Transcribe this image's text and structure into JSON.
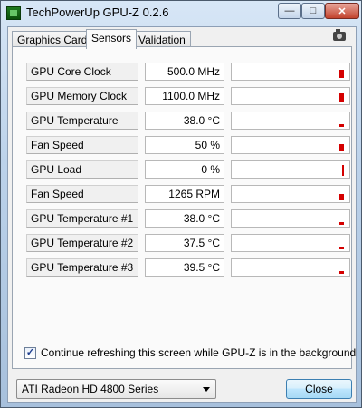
{
  "window": {
    "title": "TechPowerUp GPU-Z 0.2.6"
  },
  "tabs": [
    {
      "label": "Graphics Card",
      "active": false
    },
    {
      "label": "Sensors",
      "active": true
    },
    {
      "label": "Validation",
      "active": false
    }
  ],
  "icons": {
    "app": "gpuz-app-icon",
    "camera": "camera-icon",
    "minimize": "minimize-icon",
    "maximize": "maximize-icon",
    "close": "close-icon",
    "dropdown": "chevron-down-icon"
  },
  "colors": {
    "graph_bar": "#d40000",
    "close_button_border": "#3c7fb1"
  },
  "sensors": [
    {
      "label": "GPU Core Clock",
      "value": "500.0 MHz"
    },
    {
      "label": "GPU Memory Clock",
      "value": "1100.0 MHz"
    },
    {
      "label": "GPU Temperature",
      "value": "38.0 °C"
    },
    {
      "label": "Fan Speed",
      "value": "50 %"
    },
    {
      "label": "GPU Load",
      "value": "0 %"
    },
    {
      "label": "Fan Speed",
      "value": "1265 RPM"
    },
    {
      "label": "GPU Temperature #1",
      "value": "38.0 °C"
    },
    {
      "label": "GPU Temperature #2",
      "value": "37.5 °C"
    },
    {
      "label": "GPU Temperature #3",
      "value": "39.5 °C"
    }
  ],
  "footer": {
    "refresh_checked": true,
    "refresh_label": "Continue refreshing this screen while GPU-Z is in the background",
    "gpu_selected": "ATI Radeon HD 4800 Series",
    "close_label": "Close"
  }
}
